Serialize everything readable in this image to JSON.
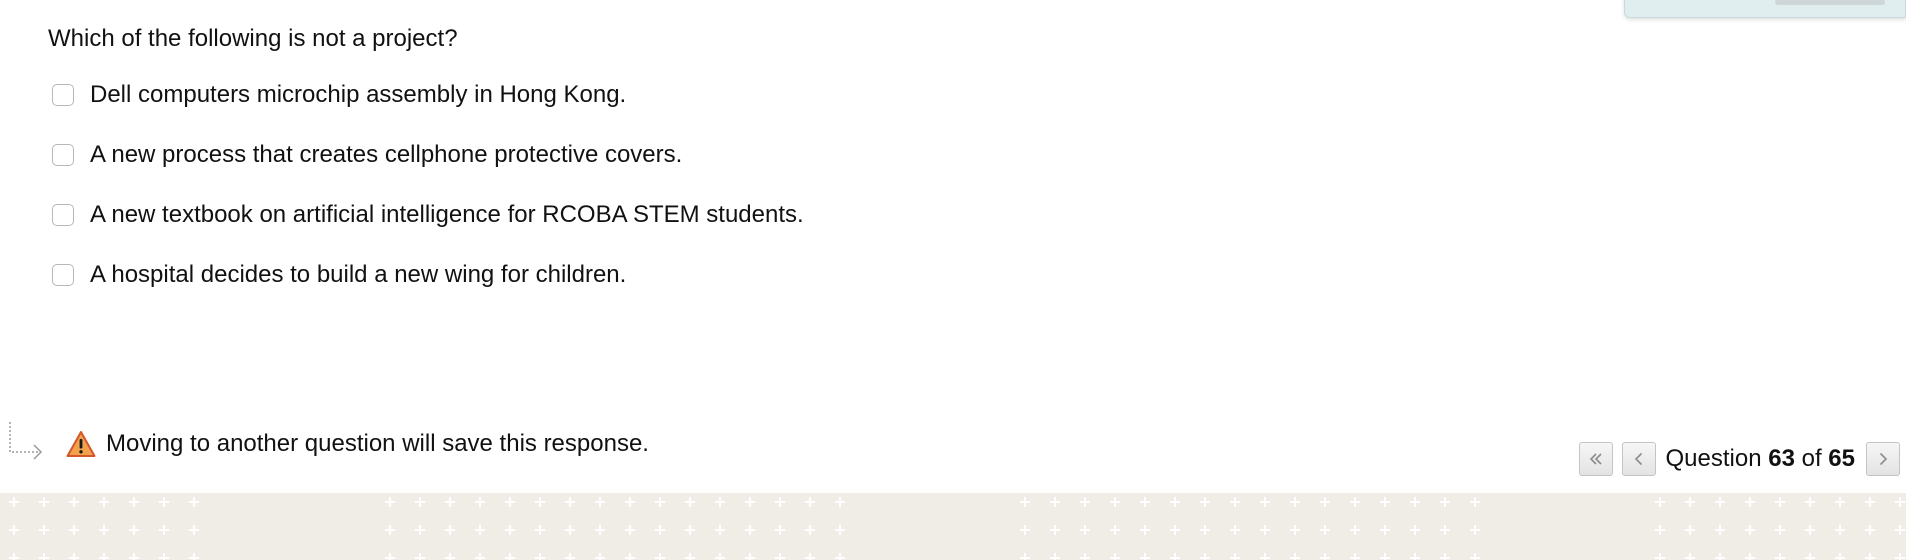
{
  "question": {
    "text": "Which of the following is not a project?"
  },
  "options": [
    {
      "label": "Dell computers microchip assembly in Hong Kong.",
      "checked": false
    },
    {
      "label": "A new process that creates cellphone protective covers.",
      "checked": false
    },
    {
      "label": "A new textbook on artificial intelligence for RCOBA STEM students.",
      "checked": false
    },
    {
      "label": "A hospital decides to build a new wing for children.",
      "checked": false
    }
  ],
  "warning": {
    "icon": "warning-triangle-icon",
    "text": "Moving to another question will save this response."
  },
  "pager": {
    "prefix": "Question",
    "current": "63",
    "of": "of",
    "total": "65",
    "first_icon": "double-chevron-left-icon",
    "prev_icon": "chevron-left-icon",
    "next_icon": "chevron-right-icon"
  },
  "colors": {
    "footer_band": "#efede6",
    "footer_cross": "#ffffff",
    "warning_fill": "#f4a14b",
    "warning_stroke": "#d2572b"
  }
}
